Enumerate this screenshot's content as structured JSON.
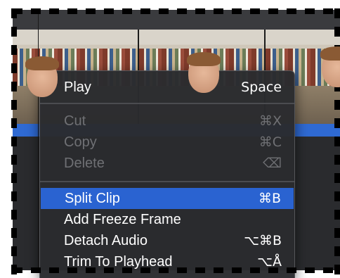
{
  "menu": {
    "items": [
      {
        "label": "Play",
        "shortcut": "Space",
        "enabled": true,
        "highlighted": false
      },
      {
        "label": "Cut",
        "shortcut": "⌘X",
        "enabled": false,
        "highlighted": false
      },
      {
        "label": "Copy",
        "shortcut": "⌘C",
        "enabled": false,
        "highlighted": false
      },
      {
        "label": "Delete",
        "shortcut": "⌫",
        "enabled": false,
        "highlighted": false
      },
      {
        "label": "Split Clip",
        "shortcut": "⌘B",
        "enabled": true,
        "highlighted": true
      },
      {
        "label": "Add Freeze Frame",
        "shortcut": "",
        "enabled": true,
        "highlighted": false
      },
      {
        "label": "Detach Audio",
        "shortcut": "⌥⌘B",
        "enabled": true,
        "highlighted": false
      },
      {
        "label": "Trim To Playhead",
        "shortcut": "⌥Å",
        "enabled": true,
        "highlighted": false
      }
    ]
  },
  "colors": {
    "highlight": "#2a63d1",
    "clip": "#2f6ad3",
    "menu_bg": "#2a2b2e",
    "disabled_text": "#6f7074"
  }
}
